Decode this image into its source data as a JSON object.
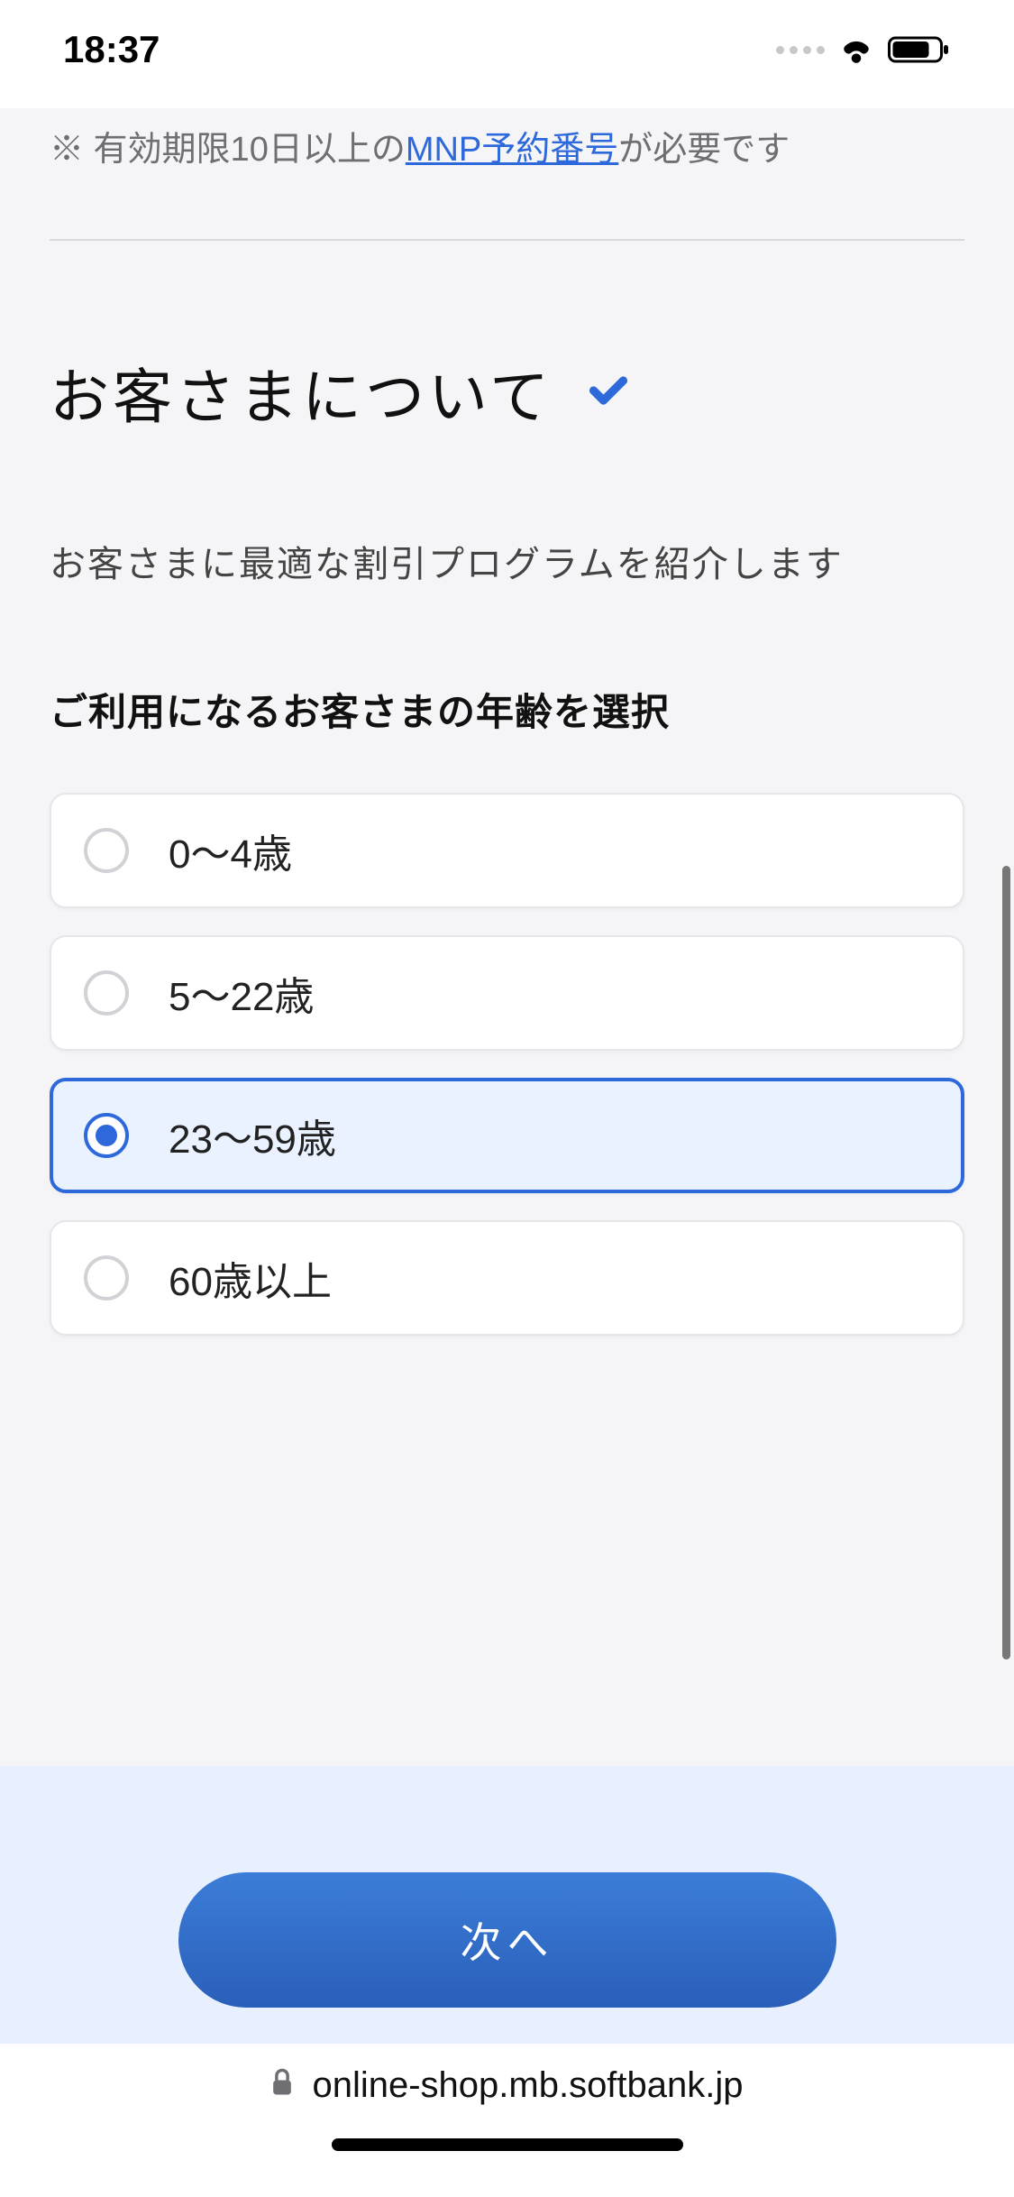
{
  "status": {
    "time": "18:37"
  },
  "note": {
    "prefix": "※ 有効期限10日以上の",
    "link": "MNP予約番号",
    "suffix": "が必要です"
  },
  "section": {
    "title": "お客さまについて",
    "desc": "お客さまに最適な割引プログラムを紹介します",
    "field_label": "ご利用になるお客さまの年齢を選択"
  },
  "options": [
    {
      "label": "0〜4歳",
      "selected": false
    },
    {
      "label": "5〜22歳",
      "selected": false
    },
    {
      "label": "23〜59歳",
      "selected": true
    },
    {
      "label": "60歳以上",
      "selected": false
    }
  ],
  "footer": {
    "next": "次へ"
  },
  "browser": {
    "url": "online-shop.mb.softbank.jp"
  }
}
